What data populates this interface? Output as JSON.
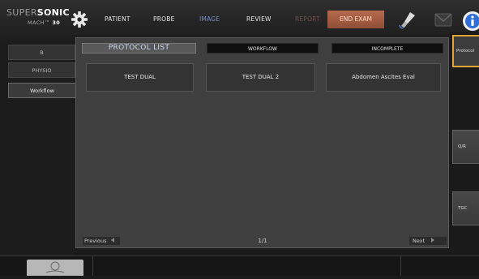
{
  "brand": {
    "wordmark_regular": "SUPER",
    "wordmark_bold": "SONIC",
    "model_regular": "MACH",
    "model_bold": "30",
    "model_suffix": "™",
    "logo_name": "gear-logo-icon"
  },
  "nav": {
    "patient": "PATIENT",
    "probe": "PROBE",
    "image": "IMAGE",
    "review": "REVIEW",
    "report": "REPORT",
    "end_exam": "END EXAM",
    "active": "IMAGE",
    "disabled": "REPORT"
  },
  "header_icons": [
    "probe-icon",
    "mail-icon",
    "info-icon"
  ],
  "left_tabs": [
    {
      "label": "B"
    },
    {
      "label": "PHYSIO"
    },
    {
      "label": "Workflow"
    }
  ],
  "left_tabs_selected": "Workflow",
  "panel": {
    "title": "PROTOCOL LIST",
    "workflow_label": "WORKFLOW",
    "incomplete_label": "INCOMPLETE",
    "protocols": [
      {
        "name": "TEST DUAL"
      },
      {
        "name": "TEST DUAL 2"
      },
      {
        "name": "Abdomen Ascites Eval"
      }
    ],
    "pagination": {
      "previous": "Previous",
      "page": "1/1",
      "next": "Next"
    }
  },
  "right_buttons": {
    "protocol": "Protocol",
    "qr": "Q/R",
    "tgc": "TGC",
    "selected": "Protocol"
  },
  "colors": {
    "accent_selected": "#e3a437",
    "nav_active": "#6f8fd1",
    "end_exam": "#a15c40",
    "panel_bg": "#3f3f3f"
  }
}
